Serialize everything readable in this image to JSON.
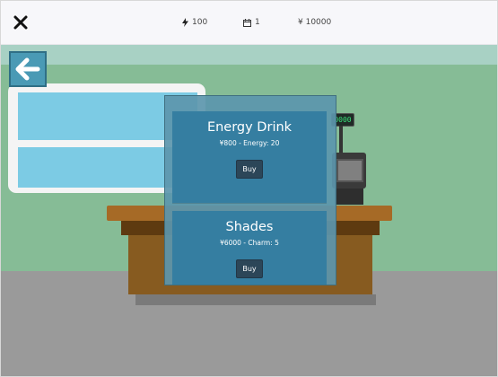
{
  "topbar": {
    "energy": "100",
    "day": "1",
    "money": "¥ 10000"
  },
  "register": {
    "display": "0000"
  },
  "shop": {
    "items": [
      {
        "name": "Energy Drink",
        "details": "¥800 - Energy: 20",
        "buy_label": "Buy"
      },
      {
        "name": "Shades",
        "details": "¥6000 - Charm: 5",
        "buy_label": "Buy"
      }
    ]
  },
  "colors": {
    "wall": "#86bc96",
    "floor": "#9a9a9a",
    "panel": "#5c96ac",
    "card": "#357ea1",
    "button": "#2c4658"
  },
  "icons": [
    "close-icon",
    "energy-icon",
    "calendar-icon",
    "back-arrow-icon"
  ]
}
